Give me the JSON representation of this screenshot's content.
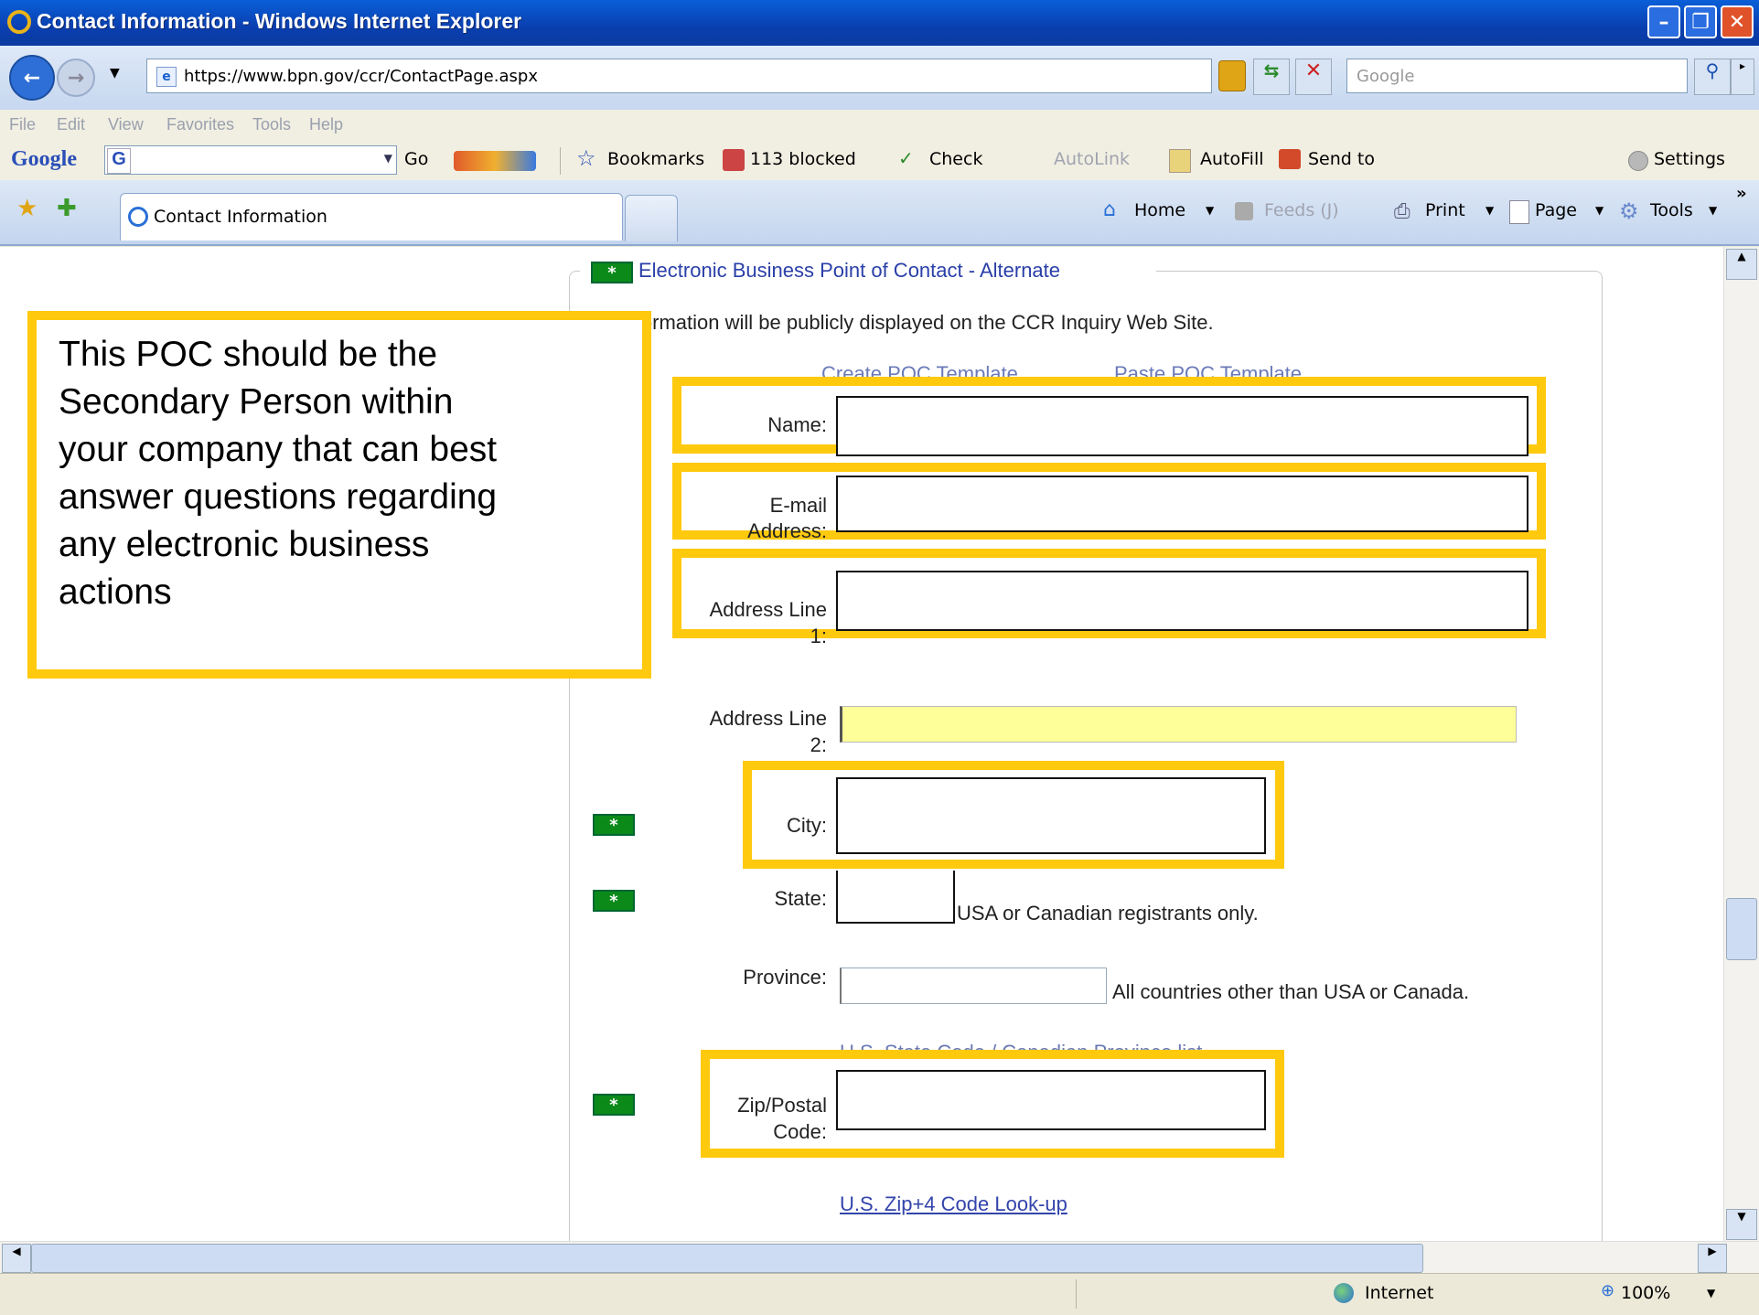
{
  "window": {
    "title": "Contact Information - Windows Internet Explorer"
  },
  "address_bar": {
    "url": "https://www.bpn.gov/ccr/ContactPage.aspx",
    "search_placeholder": "Google"
  },
  "menu": [
    "File",
    "Edit",
    "View",
    "Favorites",
    "Tools",
    "Help"
  ],
  "google_toolbar": {
    "brand": "Google",
    "go": "Go",
    "bookmarks": "Bookmarks",
    "blocked": "113 blocked",
    "check": "Check",
    "autolink": "AutoLink",
    "autofill": "AutoFill",
    "send_to": "Send to",
    "settings": "Settings"
  },
  "tab": {
    "label": "Contact Information"
  },
  "command_bar": {
    "home": "Home",
    "feeds": "Feeds (J)",
    "print": "Print",
    "page": "Page",
    "tools": "Tools"
  },
  "form": {
    "legend_star": "*",
    "legend": "Electronic Business Point of Contact - Alternate",
    "notice": "This information will be publicly displayed on the CCR Inquiry Web Site.",
    "create_template": "Create POC Template",
    "paste_template": "Paste POC Template",
    "name_label": "Name:",
    "email_label_1": "E-mail",
    "email_label_2": "Address:",
    "addr1_label_1": "Address Line",
    "addr1_label_2": "1:",
    "addr2_label_1": "Address Line",
    "addr2_label_2": "2:",
    "city_label": "City:",
    "state_label": "State:",
    "state_note": "USA or Canadian registrants only.",
    "province_label": "Province:",
    "province_note": "All countries other than USA or Canada.",
    "state_code_link": "U.S. State Code / Canadian Province list",
    "zip_label_1": "Zip/Postal",
    "zip_label_2": "Code:",
    "zip_lookup": "U.S. Zip+4 Code Look-up"
  },
  "callout": {
    "lines": [
      "This POC should be the",
      "Secondary Person within",
      "your company that can best",
      "answer questions regarding",
      "any electronic business",
      "actions"
    ]
  },
  "status": {
    "zone": "Internet",
    "zoom": "100%"
  },
  "colors": {
    "highlight": "#ffc90e",
    "required_star": "#0b8a1a",
    "addr2_fill": "#ffff99"
  }
}
